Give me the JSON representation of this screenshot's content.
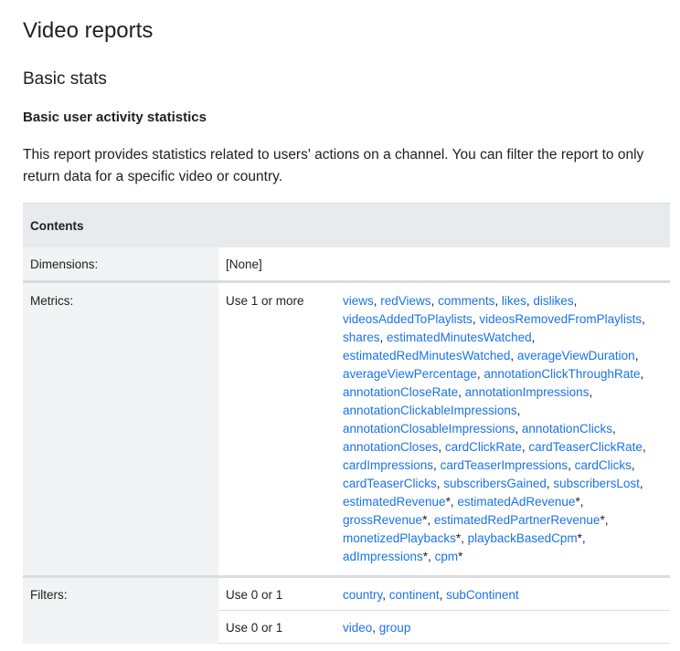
{
  "page_title": "Video reports",
  "section_title": "Basic stats",
  "subsection_title": "Basic user activity statistics",
  "description": "This report provides statistics related to users' actions on a channel. You can filter the report to only return data for a specific video or country.",
  "table": {
    "header": "Contents",
    "dimensions": {
      "label": "Dimensions:",
      "value": "[None]"
    },
    "metrics": {
      "label": "Metrics:",
      "rule": "Use 1 or more",
      "items": [
        {
          "name": "views",
          "star": false
        },
        {
          "name": "redViews",
          "star": false
        },
        {
          "name": "comments",
          "star": false
        },
        {
          "name": "likes",
          "star": false
        },
        {
          "name": "dislikes",
          "star": false
        },
        {
          "name": "videosAddedToPlaylists",
          "star": false
        },
        {
          "name": "videosRemovedFromPlaylists",
          "star": false
        },
        {
          "name": "shares",
          "star": false
        },
        {
          "name": "estimatedMinutesWatched",
          "star": false
        },
        {
          "name": "estimatedRedMinutesWatched",
          "star": false
        },
        {
          "name": "averageViewDuration",
          "star": false
        },
        {
          "name": "averageViewPercentage",
          "star": false
        },
        {
          "name": "annotationClickThroughRate",
          "star": false
        },
        {
          "name": "annotationCloseRate",
          "star": false
        },
        {
          "name": "annotationImpressions",
          "star": false
        },
        {
          "name": "annotationClickableImpressions",
          "star": false
        },
        {
          "name": "annotationClosableImpressions",
          "star": false
        },
        {
          "name": "annotationClicks",
          "star": false
        },
        {
          "name": "annotationCloses",
          "star": false
        },
        {
          "name": "cardClickRate",
          "star": false
        },
        {
          "name": "cardTeaserClickRate",
          "star": false
        },
        {
          "name": "cardImpressions",
          "star": false
        },
        {
          "name": "cardTeaserImpressions",
          "star": false
        },
        {
          "name": "cardClicks",
          "star": false
        },
        {
          "name": "cardTeaserClicks",
          "star": false
        },
        {
          "name": "subscribersGained",
          "star": false
        },
        {
          "name": "subscribersLost",
          "star": false
        },
        {
          "name": "estimatedRevenue",
          "star": true
        },
        {
          "name": "estimatedAdRevenue",
          "star": true
        },
        {
          "name": "grossRevenue",
          "star": true
        },
        {
          "name": "estimatedRedPartnerRevenue",
          "star": true
        },
        {
          "name": "monetizedPlaybacks",
          "star": true
        },
        {
          "name": "playbackBasedCpm",
          "star": true
        },
        {
          "name": "adImpressions",
          "star": true
        },
        {
          "name": "cpm",
          "star": true
        }
      ]
    },
    "filters": {
      "label": "Filters:",
      "groups": [
        {
          "rule": "Use 0 or 1",
          "items": [
            "country",
            "continent",
            "subContinent"
          ]
        },
        {
          "rule": "Use 0 or 1",
          "items": [
            "video",
            "group"
          ]
        }
      ]
    }
  },
  "colors": {
    "link": "#1a73e8",
    "header_bg": "#e8eaed",
    "label_bg": "#f1f3f4",
    "rule": "#dadce0"
  }
}
